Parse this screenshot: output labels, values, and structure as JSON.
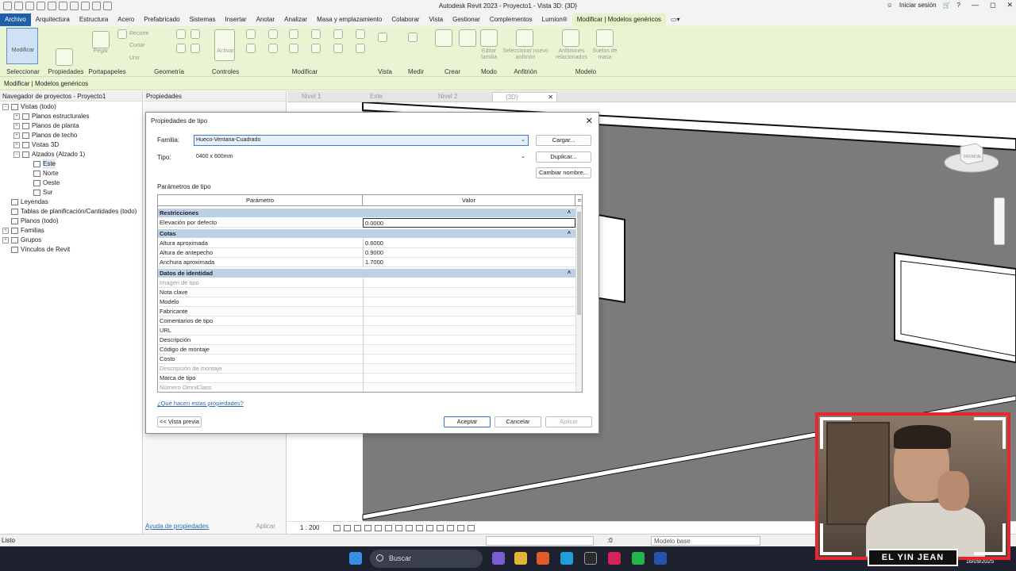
{
  "app": {
    "title": "Autodesk Revit 2023 - Proyecto1 - Vista 3D: {3D}",
    "signin": "Iniciar sesión"
  },
  "menu": {
    "tabs": [
      "Archivo",
      "Arquitectura",
      "Estructura",
      "Acero",
      "Prefabricado",
      "Sistemas",
      "Insertar",
      "Anotar",
      "Analizar",
      "Masa y emplazamiento",
      "Colaborar",
      "Vista",
      "Gestionar",
      "Complementos",
      "Lumion®",
      "Modificar | Modelos genéricos"
    ],
    "active": "Modificar | Modelos genéricos"
  },
  "ribbon": {
    "modify_label": "Modificar",
    "buttons": {
      "paste": "Pegar",
      "cut": "Cortar",
      "recorte": "Recorte",
      "unir": "Unir",
      "activar": "Activar",
      "editar_familia": "Editar familia",
      "seleccionar_anfitrion": "Seleccionar nuevo anfitrión",
      "anfitriones": "Anfitriones relacionados",
      "suelos_masa": "Suelos de masa"
    },
    "panels": [
      "Seleccionar",
      "Propiedades",
      "Portapapeles",
      "Geometría",
      "Controles",
      "Modificar",
      "Vista",
      "Medir",
      "Crear",
      "Modo",
      "Anfitrión",
      "Modelo"
    ]
  },
  "options_bar": "Modificar | Modelos genéricos",
  "browser": {
    "title": "Navegador de proyectos - Proyecto1",
    "nodes": [
      {
        "label": "Vistas (todo)",
        "level": 0,
        "toggle": "−"
      },
      {
        "label": "Planos estructurales",
        "level": 1,
        "toggle": "+"
      },
      {
        "label": "Planos de planta",
        "level": 1,
        "toggle": "+"
      },
      {
        "label": "Planos de techo",
        "level": 1,
        "toggle": "+"
      },
      {
        "label": "Vistas 3D",
        "level": 1,
        "toggle": "+"
      },
      {
        "label": "Alzados (Alzado 1)",
        "level": 1,
        "toggle": "−"
      },
      {
        "label": "Este",
        "level": 2,
        "toggle": ""
      },
      {
        "label": "Norte",
        "level": 2,
        "toggle": ""
      },
      {
        "label": "Oeste",
        "level": 2,
        "toggle": ""
      },
      {
        "label": "Sur",
        "level": 2,
        "toggle": ""
      },
      {
        "label": "Leyendas",
        "level": 0,
        "toggle": ""
      },
      {
        "label": "Tablas de planificación/Cantidades (todo)",
        "level": 0,
        "toggle": ""
      },
      {
        "label": "Planos (todo)",
        "level": 0,
        "toggle": ""
      },
      {
        "label": "Familias",
        "level": 0,
        "toggle": "+"
      },
      {
        "label": "Grupos",
        "level": 0,
        "toggle": "+"
      },
      {
        "label": "Vínculos de Revit",
        "level": 0,
        "toggle": ""
      }
    ]
  },
  "properties": {
    "title": "Propiedades",
    "help_link": "Ayuda de propiedades",
    "apply": "Aplicar"
  },
  "view_tabs": [
    {
      "label": "Nivel 1",
      "active": false
    },
    {
      "label": "Este",
      "active": false
    },
    {
      "label": "Nivel 2",
      "active": false
    },
    {
      "label": "{3D}",
      "active": true,
      "close": "✕"
    }
  ],
  "viewport": {
    "viewcube_label": "FRONTAL",
    "scale": "1 : 200"
  },
  "statusbar": {
    "left": "Listo",
    "zero": ":0",
    "model": "Modelo base"
  },
  "taskbar": {
    "search": "Buscar",
    "date": "16/09/2025"
  },
  "dialog": {
    "title": "Propiedades de tipo",
    "close": "✕",
    "family_label": "Familia:",
    "family_value": "Hueco-Ventana-Cuadrado",
    "type_label": "Tipo:",
    "type_value": "0400 x 600mm",
    "btn_load": "Cargar...",
    "btn_duplicate": "Duplicar...",
    "btn_rename": "Cambiar nombre...",
    "type_params_label": "Parámetros de tipo",
    "col_param": "Parámetro",
    "col_value": "Valor",
    "col_extra": "=",
    "rows": [
      {
        "kind": "group",
        "p": "Restricciones",
        "v": ""
      },
      {
        "kind": "row",
        "p": "Elevación por defecto",
        "v": "0.0000",
        "edit": true
      },
      {
        "kind": "group",
        "p": "Cotas",
        "v": ""
      },
      {
        "kind": "row",
        "p": "Altura aproximada",
        "v": "0.6000"
      },
      {
        "kind": "row",
        "p": "Altura de antepecho",
        "v": "0.9000"
      },
      {
        "kind": "row",
        "p": "Anchura aproximada",
        "v": "1.7000"
      },
      {
        "kind": "group",
        "p": "Datos de identidad",
        "v": ""
      },
      {
        "kind": "dis",
        "p": "Imagen de tipo",
        "v": ""
      },
      {
        "kind": "row",
        "p": "Nota clave",
        "v": ""
      },
      {
        "kind": "row",
        "p": "Modelo",
        "v": ""
      },
      {
        "kind": "row",
        "p": "Fabricante",
        "v": ""
      },
      {
        "kind": "row",
        "p": "Comentarios de tipo",
        "v": ""
      },
      {
        "kind": "row",
        "p": "URL",
        "v": ""
      },
      {
        "kind": "row",
        "p": "Descripción",
        "v": ""
      },
      {
        "kind": "row",
        "p": "Código de montaje",
        "v": ""
      },
      {
        "kind": "row",
        "p": "Costo",
        "v": ""
      },
      {
        "kind": "dis",
        "p": "Descripción de montaje",
        "v": ""
      },
      {
        "kind": "row",
        "p": "Marca de tipo",
        "v": ""
      },
      {
        "kind": "dis",
        "p": "Número OmniClass",
        "v": ""
      }
    ],
    "help_link": "¿Qué hacen estas propiedades?",
    "btn_preview": "<< Vista previa",
    "btn_ok": "Aceptar",
    "btn_cancel": "Cancelar",
    "btn_apply": "Aplicar"
  },
  "overlay": {
    "banner": "EL YIN JEAN"
  },
  "colors": {
    "ribbon_bg": "#e9f5d2",
    "file_tab": "#1f5ea8",
    "group_row": "#bcd0e8",
    "webcam_border": "#e8262f"
  }
}
